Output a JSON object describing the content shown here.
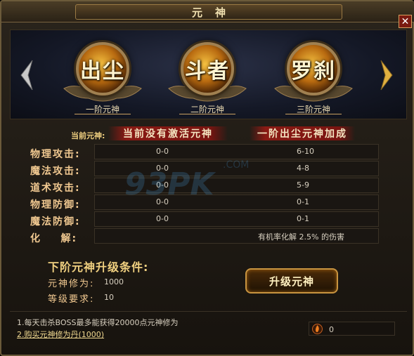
{
  "window": {
    "title": "元神",
    "close_label": "✕"
  },
  "nav": {
    "prev_icon": "chevron-left-icon",
    "next_icon": "chevron-right-icon"
  },
  "tiers": [
    {
      "glyph": "出尘",
      "label": "一阶元神"
    },
    {
      "glyph": "斗者",
      "label": "二阶元神"
    },
    {
      "glyph": "罗刹",
      "label": "三阶元神"
    }
  ],
  "current": {
    "label": "当前元神:",
    "status": "当前没有激活元神",
    "bonus": "一阶出尘元神加成"
  },
  "stats": [
    {
      "label": "物理攻击:",
      "current": "0-0",
      "next": "6-10"
    },
    {
      "label": "魔法攻击:",
      "current": "0-0",
      "next": "4-8"
    },
    {
      "label": "道术攻击:",
      "current": "0-0",
      "next": "5-9"
    },
    {
      "label": "物理防御:",
      "current": "0-0",
      "next": "0-1"
    },
    {
      "label": "魔法防御:",
      "current": "0-0",
      "next": "0-1"
    },
    {
      "label": "化    解:",
      "value": "有机率化解 2.5% 的伤害"
    }
  ],
  "upgrade": {
    "title": "下阶元神升级条件:",
    "req1_label": "元神修为:",
    "req1_value": "1000",
    "req2_label": "等级要求:",
    "req2_value": "10",
    "button_label": "升级元神"
  },
  "tips": {
    "tip1": "1.每天击杀BOSS最多能获得20000点元神修为",
    "tip2": "2.购买元神修为丹(1000)"
  },
  "currency": {
    "icon": "flame-icon",
    "value": "0"
  },
  "watermark": {
    "text": "93PK",
    "domain": ".COM"
  },
  "colors": {
    "accent_gold": "#f0d080",
    "banner_red": "#8a1a14",
    "orb_orange": "#b86a10"
  }
}
